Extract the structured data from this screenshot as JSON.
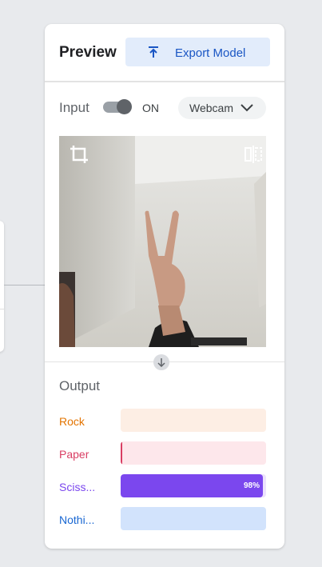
{
  "preview": {
    "title": "Preview",
    "export_label": "Export Model"
  },
  "input": {
    "label": "Input",
    "toggle_state": "ON",
    "source": "Webcam"
  },
  "output": {
    "label": "Output",
    "classes": [
      {
        "name": "Rock",
        "confidence": 0,
        "color": "#e37400",
        "bg": "#fdeee4",
        "show_pct": false
      },
      {
        "name": "Paper",
        "confidence": 0.01,
        "color": "#d93e63",
        "bg": "#fde7eb",
        "show_pct": false
      },
      {
        "name": "Sciss...",
        "confidence": 0.98,
        "pct_label": "98%",
        "color": "#7b47ee",
        "bg": "#ece2fd",
        "show_pct": true
      },
      {
        "name": "Nothi...",
        "confidence": 0,
        "color": "#1967d2",
        "bg": "#d2e3fc",
        "show_pct": false
      }
    ]
  }
}
